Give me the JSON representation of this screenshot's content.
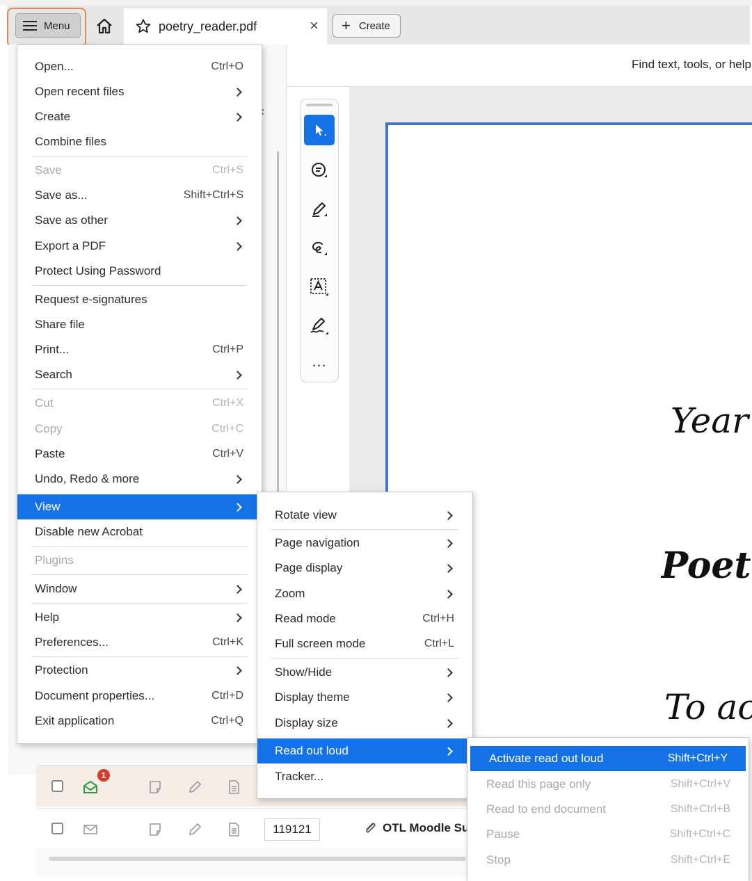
{
  "tabbar": {
    "menu_label": "Menu",
    "document_tab_title": "poetry_reader.pdf",
    "close_glyph": "×",
    "create_label": "Create",
    "plus_glyph": "+"
  },
  "toolbar": {
    "search_hint": "Find text, tools, or help",
    "collapse_glyph": "‹"
  },
  "tools": {
    "more_glyph": "…"
  },
  "document": {
    "line1": "Year",
    "line2": "Poetr",
    "line3": "To ac"
  },
  "inbox": {
    "badge_count": "1",
    "row2_id": "119121",
    "row2_subject": "OTL Moodle Su"
  },
  "main_menu": {
    "items": [
      {
        "label": "Open...",
        "shortcut": "Ctrl+O"
      },
      {
        "label": "Open recent files"
      },
      {
        "label": "Create"
      },
      {
        "label": "Combine files"
      },
      {
        "label": "Save",
        "shortcut": "Ctrl+S"
      },
      {
        "label": "Save as...",
        "shortcut": "Shift+Ctrl+S"
      },
      {
        "label": "Save as other"
      },
      {
        "label": "Export a PDF"
      },
      {
        "label": "Protect Using Password"
      },
      {
        "label": "Request e-signatures"
      },
      {
        "label": "Share file"
      },
      {
        "label": "Print...",
        "shortcut": "Ctrl+P"
      },
      {
        "label": "Search"
      },
      {
        "label": "Cut",
        "shortcut": "Ctrl+X"
      },
      {
        "label": "Copy",
        "shortcut": "Ctrl+C"
      },
      {
        "label": "Paste",
        "shortcut": "Ctrl+V"
      },
      {
        "label": "Undo, Redo & more"
      },
      {
        "label": "View"
      },
      {
        "label": "Disable new Acrobat"
      },
      {
        "label": "Plugins"
      },
      {
        "label": "Window"
      },
      {
        "label": "Help"
      },
      {
        "label": "Preferences...",
        "shortcut": "Ctrl+K"
      },
      {
        "label": "Protection"
      },
      {
        "label": "Document properties...",
        "shortcut": "Ctrl+D"
      },
      {
        "label": "Exit application",
        "shortcut": "Ctrl+Q"
      }
    ]
  },
  "view_menu": {
    "items": [
      {
        "label": "Rotate view"
      },
      {
        "label": "Page navigation"
      },
      {
        "label": "Page display"
      },
      {
        "label": "Zoom"
      },
      {
        "label": "Read mode",
        "shortcut": "Ctrl+H"
      },
      {
        "label": "Full screen mode",
        "shortcut": "Ctrl+L"
      },
      {
        "label": "Show/Hide"
      },
      {
        "label": "Display theme"
      },
      {
        "label": "Display size"
      },
      {
        "label": "Read out loud"
      },
      {
        "label": "Tracker..."
      }
    ]
  },
  "read_menu": {
    "items": [
      {
        "label": "Activate read out loud",
        "shortcut": "Shift+Ctrl+Y"
      },
      {
        "label": "Read this page only",
        "shortcut": "Shift+Ctrl+V"
      },
      {
        "label": "Read to end document",
        "shortcut": "Shift+Ctrl+B"
      },
      {
        "label": "Pause",
        "shortcut": "Shift+Ctrl+C"
      },
      {
        "label": "Stop",
        "shortcut": "Shift+Ctrl+E"
      }
    ]
  },
  "colors": {
    "accent": "#1472e6",
    "highlight_outline": "#e08a57",
    "page_border": "#4575c4",
    "badge": "#d63b2b"
  },
  "icons": {
    "menu": "hamburger-icon",
    "home": "home-icon",
    "favorite": "star-icon",
    "select": "cursor-icon",
    "comment": "comment-icon",
    "highlight": "pen-icon",
    "draw": "lasso-icon",
    "text_recognition": "text-box-icon",
    "sign": "signature-icon"
  }
}
